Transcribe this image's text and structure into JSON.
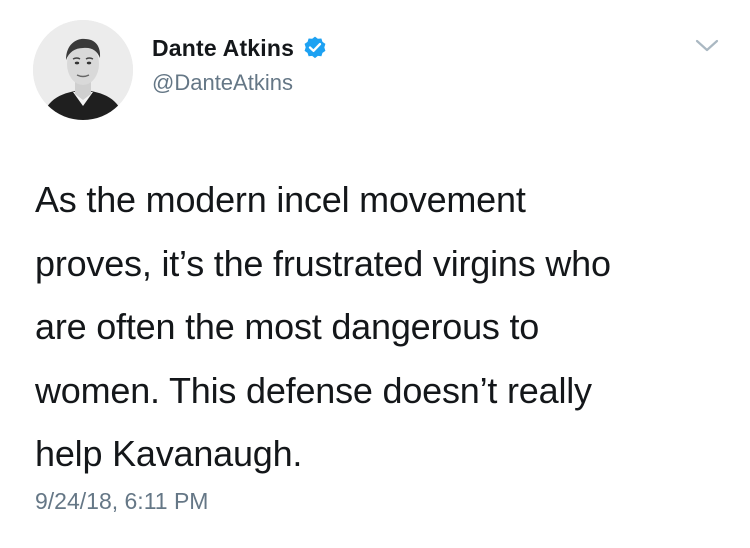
{
  "author": {
    "display_name": "Dante Atkins",
    "handle": "@DanteAtkins",
    "verified": true,
    "avatar_icon": "profile-photo"
  },
  "tweet": {
    "lines": [
      "As the modern incel movement",
      "proves, it’s the frustrated virgins who",
      "are often the most dangerous to",
      "women. This defense doesn’t really",
      "help Kavanaugh."
    ],
    "timestamp": "9/24/18, 6:11 PM"
  },
  "colors": {
    "verified_badge": "#1da1f2",
    "secondary_text": "#657786",
    "primary_text": "#14171a",
    "chevron": "#aab8c2"
  },
  "icons": {
    "verified": "verified-badge-icon",
    "menu": "chevron-down-icon"
  }
}
